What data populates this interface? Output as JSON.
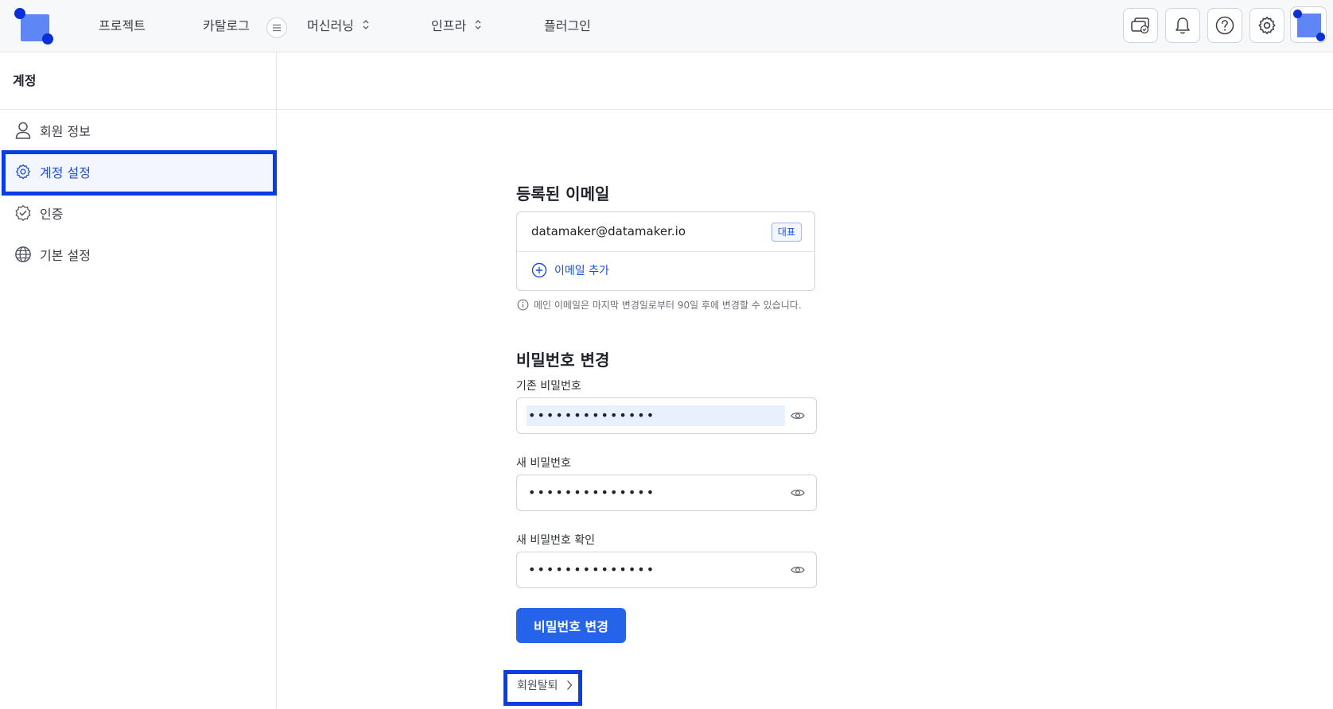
{
  "nav": {
    "items": [
      {
        "label": "프로젝트",
        "has_dropdown": false
      },
      {
        "label": "카탈로그",
        "has_dropdown": false
      },
      {
        "label": "머신러닝",
        "has_dropdown": true
      },
      {
        "label": "인프라",
        "has_dropdown": true
      },
      {
        "label": "플러그인",
        "has_dropdown": false
      }
    ],
    "icons": [
      "workspace-icon",
      "bell-icon",
      "help-icon",
      "gear-icon"
    ]
  },
  "sidebar": {
    "title": "계정",
    "items": [
      {
        "label": "회원 정보",
        "icon": "user-icon",
        "active": false
      },
      {
        "label": "계정 설정",
        "icon": "gear-icon",
        "active": true
      },
      {
        "label": "인증",
        "icon": "verified-badge-icon",
        "active": false
      },
      {
        "label": "기본 설정",
        "icon": "globe-icon",
        "active": false
      }
    ]
  },
  "email_section": {
    "title": "등록된 이메일",
    "email": "datamaker@datamaker.io",
    "badge": "대표",
    "add_label": "이메일 추가",
    "note": "메인 이메일은 마지막 변경일로부터 90일 후에 변경할 수 있습니다."
  },
  "password_section": {
    "title": "비밀번호 변경",
    "fields": [
      {
        "label": "기존 비밀번호",
        "value": "••••••••••••••",
        "autofilled": true
      },
      {
        "label": "새 비밀번호",
        "value": "••••••••••••••",
        "autofilled": false
      },
      {
        "label": "새 비밀번호 확인",
        "value": "••••••••••••••",
        "autofilled": false
      }
    ],
    "submit_label": "비밀번호 변경"
  },
  "withdraw_label": "회원탈퇴",
  "colors": {
    "accent": "#2563eb",
    "accent_text": "#1d4ed8",
    "highlight_border": "#0a3de0",
    "logo": "#5e87f5"
  }
}
